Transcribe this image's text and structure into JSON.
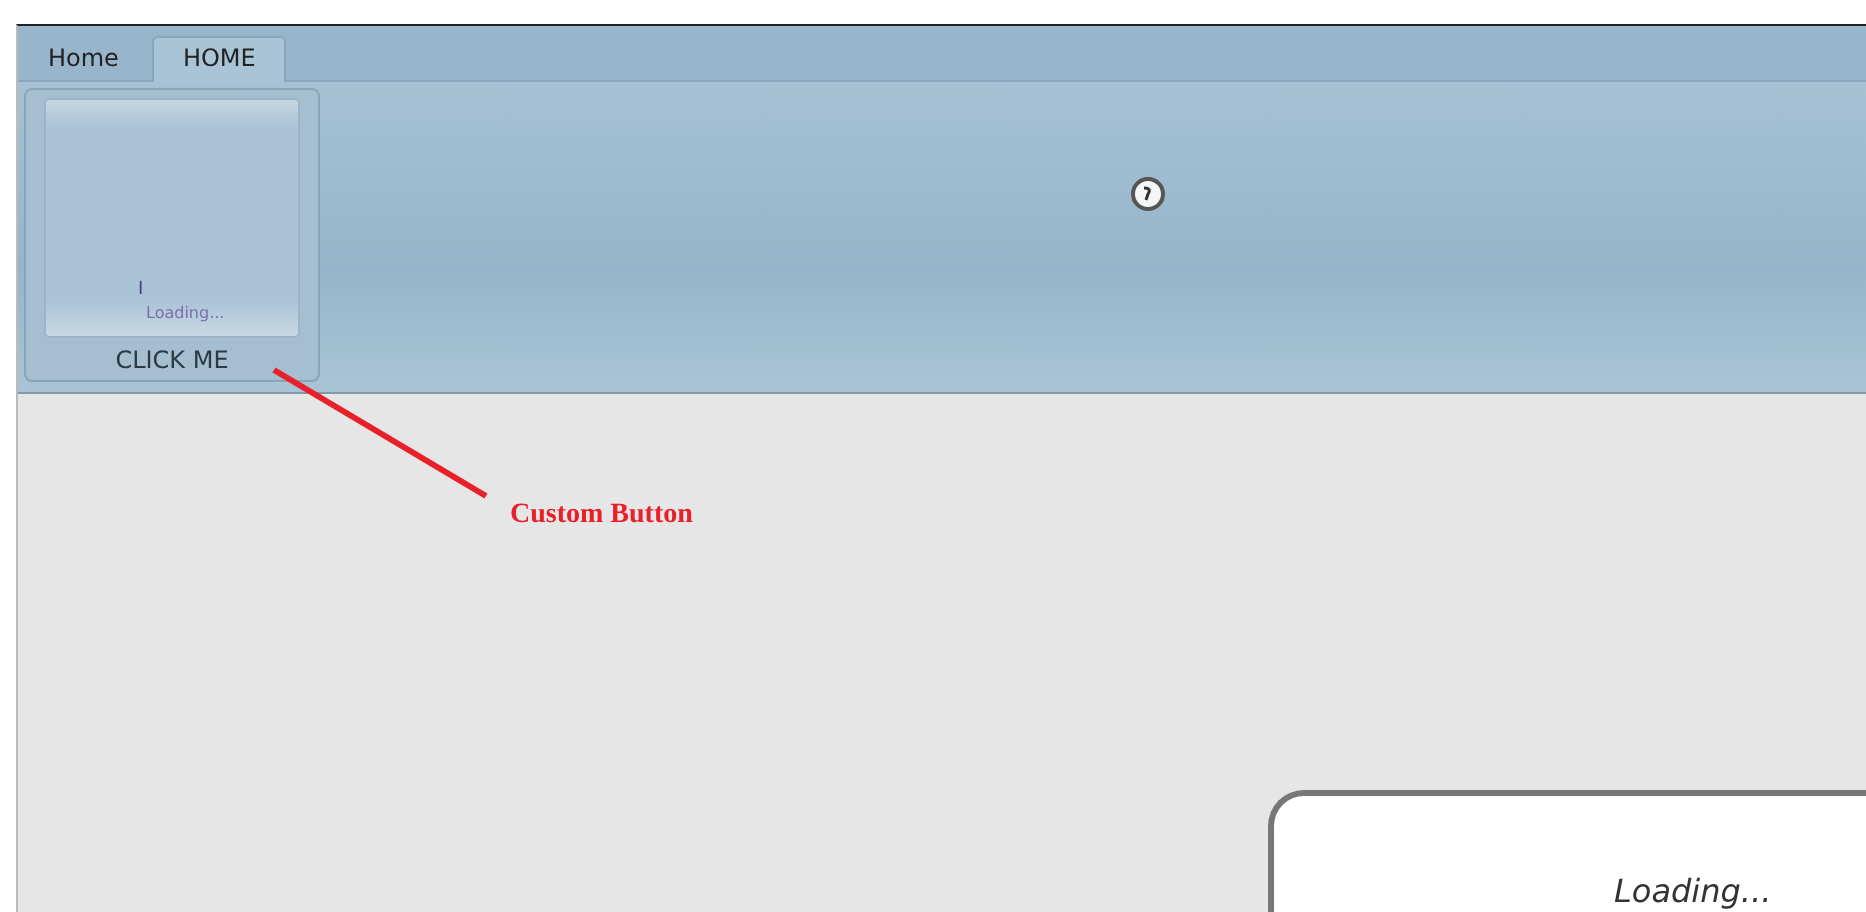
{
  "tabs": [
    {
      "label": "Home",
      "selected": false
    },
    {
      "label": "HOME",
      "selected": true
    }
  ],
  "ribbon": {
    "button": {
      "label": "CLICK ME",
      "preview": {
        "cursor": "I",
        "text": "Loading..."
      }
    }
  },
  "annotation": {
    "text": "Custom Button"
  },
  "dialog": {
    "text": "Loading..."
  }
}
